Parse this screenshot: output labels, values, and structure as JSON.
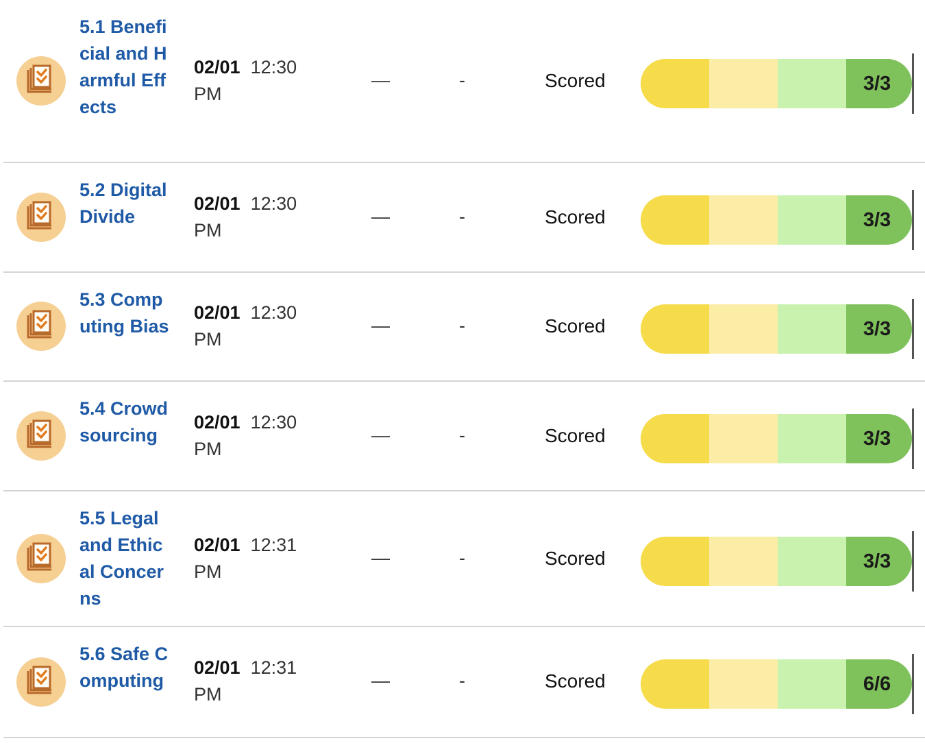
{
  "colors": {
    "title_link": "#1f5aa6",
    "icon_bg": "#f6cf93",
    "icon_stroke": "#b86a2a",
    "seg1": "#f6dc4a",
    "seg2": "#fbeda6",
    "seg3": "#c9f2ae",
    "seg4": "#7fc15b",
    "divider": "#d4d4d4"
  },
  "assignments": [
    {
      "icon": "assignment-checklist-icon",
      "title": "5.1 Beneficial and Harmful Effects",
      "due_date": "02/01",
      "due_time": "12:30",
      "due_period": "PM",
      "dash_long": "—",
      "dash_short": "-",
      "status": "Scored",
      "score": "3/3",
      "progress": 1.0
    },
    {
      "icon": "assignment-checklist-icon",
      "title": "5.2 Digital Divide",
      "due_date": "02/01",
      "due_time": "12:30",
      "due_period": "PM",
      "dash_long": "—",
      "dash_short": "-",
      "status": "Scored",
      "score": "3/3",
      "progress": 1.0
    },
    {
      "icon": "assignment-checklist-icon",
      "title": "5.3 Computing Bias",
      "due_date": "02/01",
      "due_time": "12:30",
      "due_period": "PM",
      "dash_long": "—",
      "dash_short": "-",
      "status": "Scored",
      "score": "3/3",
      "progress": 1.0
    },
    {
      "icon": "assignment-checklist-icon",
      "title": "5.4 Crowdsourcing",
      "due_date": "02/01",
      "due_time": "12:30",
      "due_period": "PM",
      "dash_long": "—",
      "dash_short": "-",
      "status": "Scored",
      "score": "3/3",
      "progress": 1.0
    },
    {
      "icon": "assignment-checklist-icon",
      "title": "5.5 Legal and Ethical Concerns",
      "due_date": "02/01",
      "due_time": "12:31",
      "due_period": "PM",
      "dash_long": "—",
      "dash_short": "-",
      "status": "Scored",
      "score": "3/3",
      "progress": 1.0
    },
    {
      "icon": "assignment-checklist-icon",
      "title": "5.6 Safe Computing",
      "due_date": "02/01",
      "due_time": "12:31",
      "due_period": "PM",
      "dash_long": "—",
      "dash_short": "-",
      "status": "Scored",
      "score": "6/6",
      "progress": 1.0
    }
  ]
}
